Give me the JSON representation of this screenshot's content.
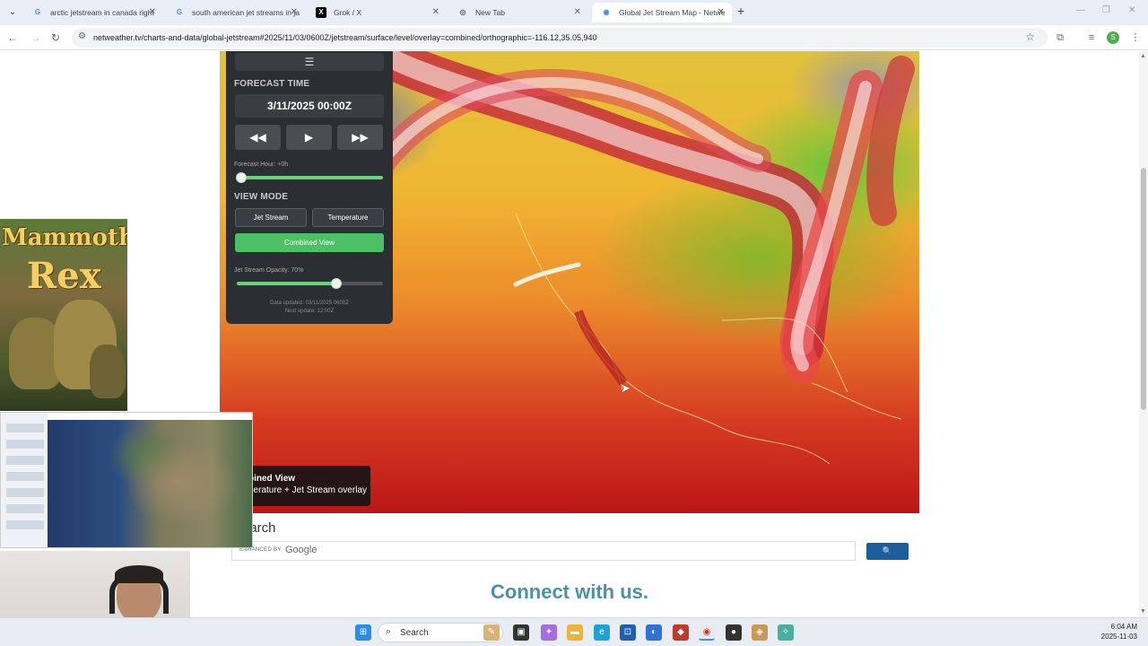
{
  "browser": {
    "tabs": [
      {
        "title": "arctic jetstream in canada right",
        "favicon": "G",
        "active": false
      },
      {
        "title": "south american jet streams in ja",
        "favicon": "G",
        "active": false
      },
      {
        "title": "Grok / X",
        "favicon": "X",
        "active": false
      },
      {
        "title": "New Tab",
        "favicon": "globe",
        "active": false
      },
      {
        "title": "Global Jet Stream Map - Netwe",
        "favicon": "G",
        "active": true
      }
    ],
    "url": "netweather.tv/charts-and-data/global-jetstream#2025/11/03/0600Z/jetstream/surface/level/overlay=combined/orthographic=-116.12,35.05,940",
    "profile_initial": "S"
  },
  "control_panel": {
    "menu_icon": "☰",
    "forecast_time_heading": "FORECAST TIME",
    "forecast_time": "3/11/2025 00:00Z",
    "rewind": "◀◀",
    "play": "▶",
    "forward": "▶▶",
    "forecast_hour_label": "Forecast Hour: +0h",
    "forecast_hour_value": 0,
    "view_mode_heading": "VIEW MODE",
    "jet_stream_button": "Jet Stream",
    "temperature_button": "Temperature",
    "combined_button": "Combined View",
    "opacity_label": "Jet Stream Opacity: 70%",
    "opacity_value": 70,
    "data_updated": "Data updated: 03/11/2025 0600Z",
    "next_update": "Next update: 12:00Z"
  },
  "map_legend": {
    "title": "Combined View",
    "subtitle": "Temperature + Jet Stream overlay",
    "visible_title": "bined View",
    "visible_subtitle": "perature + Jet Stream overlay"
  },
  "search": {
    "heading": "earch",
    "enhanced_by": "ENHANCED BY",
    "google": "Google",
    "button_icon": "🔍"
  },
  "connect_heading": "Connect with us.",
  "side_ad": {
    "line1": "Mammoth",
    "line2": "Rex"
  },
  "taskbar": {
    "search_label": "Search",
    "time": "6:04 AM",
    "date": "2025-11-03"
  },
  "colors": {
    "accent_green": "#4cc064",
    "search_button": "#1b5e9e",
    "connect_text": "#4a90a8"
  }
}
